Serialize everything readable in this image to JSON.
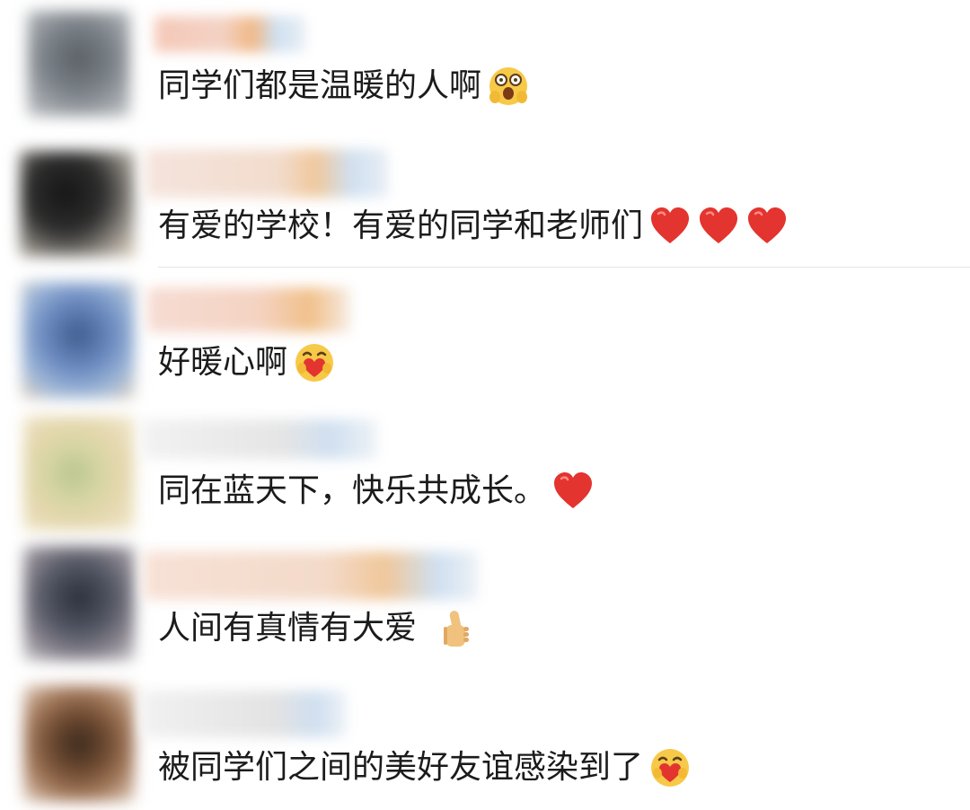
{
  "comments": [
    {
      "text": "同学们都是温暖的人啊",
      "emoji": [
        "face-scream-icon"
      ]
    },
    {
      "text": "有爱的学校！有爱的同学和老师们",
      "emoji": [
        "heart-icon",
        "heart-icon",
        "heart-icon"
      ]
    },
    {
      "text": "好暖心啊",
      "emoji": [
        "face-hugging-heart-icon"
      ]
    },
    {
      "text": "同在蓝天下，快乐共成长。",
      "emoji": [
        "heart-icon"
      ]
    },
    {
      "text": "人间有真情有大爱",
      "emoji": [
        "thumbs-up-icon"
      ]
    },
    {
      "text": "被同学们之间的美好友谊感染到了",
      "emoji": [
        "face-hugging-heart-icon"
      ]
    }
  ],
  "colors": {
    "text": "#1b1b1b",
    "heart": "#e3342f",
    "emoji_face": "#f7c948",
    "divider": "#e6e6e6"
  }
}
